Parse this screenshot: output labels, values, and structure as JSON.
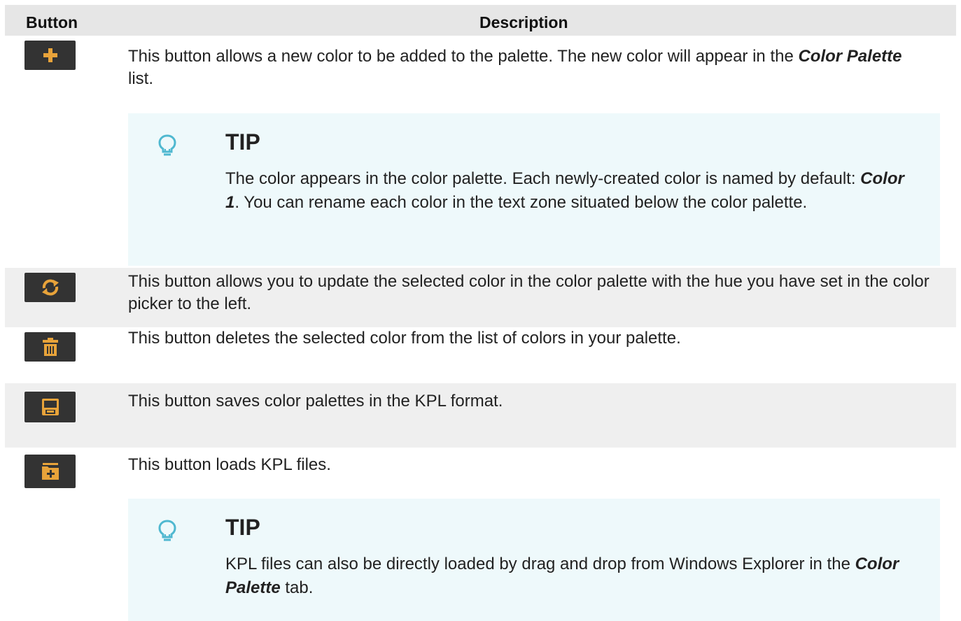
{
  "header": {
    "button_col": "Button",
    "description_col": "Description"
  },
  "rows": [
    {
      "icon": "plus-icon",
      "text_a": "This button allows a new color to be added to the palette. The new color will appear in the ",
      "text_em": "Color Palette",
      "text_b": " list.",
      "tip": {
        "title": "TIP",
        "body_a": "The color appears in the color palette. Each newly-created color is named by default: ",
        "body_em": "Color 1",
        "body_b": ". You can rename each color in the text zone situated below the color palette."
      }
    },
    {
      "icon": "refresh-icon",
      "text": "This button allows you to update the selected color in the color palette with the hue you have set in the color picker to the left."
    },
    {
      "icon": "trash-icon",
      "text": "This button deletes the selected color from the list of colors in your palette."
    },
    {
      "icon": "save-icon",
      "text": "This button saves color palettes in the KPL format."
    },
    {
      "icon": "folder-add-icon",
      "text": "This button loads KPL files.",
      "tip": {
        "title": "TIP",
        "body_a": "KPL files can also be directly loaded by drag and drop from Windows Explorer in the ",
        "body_em": "Color Palette",
        "body_b": " tab."
      }
    }
  ],
  "colors": {
    "icon_accent": "#e8a33a",
    "icon_bg": "#333333",
    "tip_bg": "#eef9fb",
    "bulb": "#4fb8d0",
    "header_bg": "#e6e6e6",
    "row_shade": "#efefef"
  }
}
